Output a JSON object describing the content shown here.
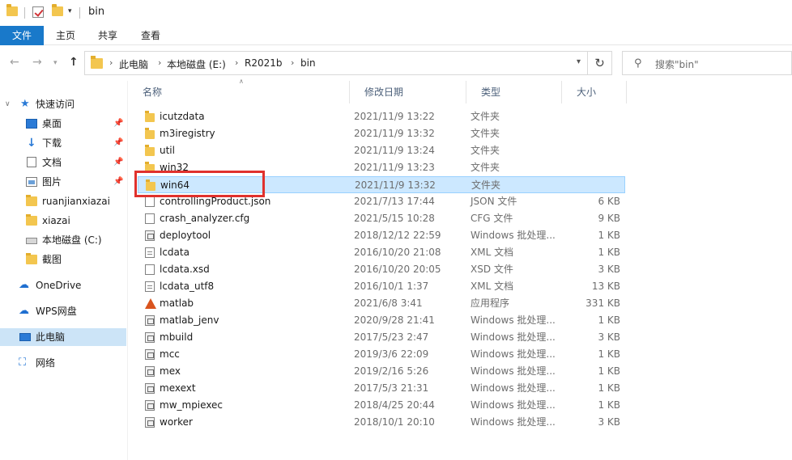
{
  "window": {
    "title": "bin"
  },
  "ribbon": {
    "tabs": [
      "文件",
      "主页",
      "共享",
      "查看"
    ]
  },
  "address": {
    "crumbs": [
      "此电脑",
      "本地磁盘 (E:)",
      "R2021b",
      "bin"
    ]
  },
  "search": {
    "placeholder": "搜索\"bin\""
  },
  "sidebar": {
    "items": [
      {
        "label": "快速访问",
        "icon": "star-icon"
      },
      {
        "label": "桌面",
        "icon": "desktop-icon",
        "pinned": true
      },
      {
        "label": "下载",
        "icon": "download-icon",
        "pinned": true
      },
      {
        "label": "文档",
        "icon": "document-icon",
        "pinned": true
      },
      {
        "label": "图片",
        "icon": "picture-icon",
        "pinned": true
      },
      {
        "label": "ruanjianxiazai",
        "icon": "folder-icon"
      },
      {
        "label": "xiazai",
        "icon": "folder-icon"
      },
      {
        "label": "本地磁盘 (C:)",
        "icon": "drive-icon"
      },
      {
        "label": "截图",
        "icon": "folder-icon"
      },
      {
        "label": "OneDrive",
        "icon": "onedrive-icon"
      },
      {
        "label": "WPS网盘",
        "icon": "cloud-icon"
      },
      {
        "label": "此电脑",
        "icon": "computer-icon",
        "selected": true
      },
      {
        "label": "网络",
        "icon": "network-icon"
      }
    ]
  },
  "columns": {
    "name": "名称",
    "date": "修改日期",
    "type": "类型",
    "size": "大小"
  },
  "files": [
    {
      "name": "icutzdata",
      "date": "2021/11/9 13:22",
      "type": "文件夹",
      "size": "",
      "kind": "folder"
    },
    {
      "name": "m3iregistry",
      "date": "2021/11/9 13:32",
      "type": "文件夹",
      "size": "",
      "kind": "folder"
    },
    {
      "name": "util",
      "date": "2021/11/9 13:24",
      "type": "文件夹",
      "size": "",
      "kind": "folder"
    },
    {
      "name": "win32",
      "date": "2021/11/9 13:23",
      "type": "文件夹",
      "size": "",
      "kind": "folder"
    },
    {
      "name": "win64",
      "date": "2021/11/9 13:32",
      "type": "文件夹",
      "size": "",
      "kind": "folder",
      "selected": true
    },
    {
      "name": "controllingProduct.json",
      "date": "2021/7/13 17:44",
      "type": "JSON 文件",
      "size": "6 KB",
      "kind": "file"
    },
    {
      "name": "crash_analyzer.cfg",
      "date": "2021/5/15 10:28",
      "type": "CFG 文件",
      "size": "9 KB",
      "kind": "file"
    },
    {
      "name": "deploytool",
      "date": "2018/12/12 22:59",
      "type": "Windows 批处理...",
      "size": "1 KB",
      "kind": "bat"
    },
    {
      "name": "lcdata",
      "date": "2016/10/20 21:08",
      "type": "XML 文档",
      "size": "1 KB",
      "kind": "xml"
    },
    {
      "name": "lcdata.xsd",
      "date": "2016/10/20 20:05",
      "type": "XSD 文件",
      "size": "3 KB",
      "kind": "file"
    },
    {
      "name": "lcdata_utf8",
      "date": "2016/10/1 1:37",
      "type": "XML 文档",
      "size": "13 KB",
      "kind": "xml"
    },
    {
      "name": "matlab",
      "date": "2021/6/8 3:41",
      "type": "应用程序",
      "size": "331 KB",
      "kind": "exe"
    },
    {
      "name": "matlab_jenv",
      "date": "2020/9/28 21:41",
      "type": "Windows 批处理...",
      "size": "1 KB",
      "kind": "bat"
    },
    {
      "name": "mbuild",
      "date": "2017/5/23 2:47",
      "type": "Windows 批处理...",
      "size": "3 KB",
      "kind": "bat"
    },
    {
      "name": "mcc",
      "date": "2019/3/6 22:09",
      "type": "Windows 批处理...",
      "size": "1 KB",
      "kind": "bat"
    },
    {
      "name": "mex",
      "date": "2019/2/16 5:26",
      "type": "Windows 批处理...",
      "size": "1 KB",
      "kind": "bat"
    },
    {
      "name": "mexext",
      "date": "2017/5/3 21:31",
      "type": "Windows 批处理...",
      "size": "1 KB",
      "kind": "bat"
    },
    {
      "name": "mw_mpiexec",
      "date": "2018/4/25 20:44",
      "type": "Windows 批处理...",
      "size": "1 KB",
      "kind": "bat"
    },
    {
      "name": "worker",
      "date": "2018/10/1 20:10",
      "type": "Windows 批处理...",
      "size": "3 KB",
      "kind": "bat"
    }
  ],
  "colors": {
    "accent": "#1979ca",
    "selection": "#cce8ff",
    "highlight": "#e0312d"
  }
}
